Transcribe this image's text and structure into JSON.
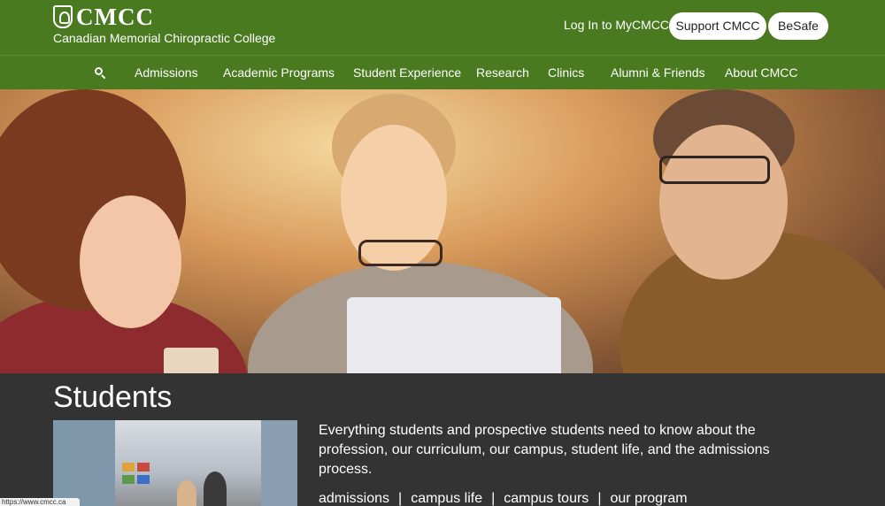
{
  "header": {
    "logo_text": "CMCC",
    "logo_subtitle": "Canadian Memorial Chiropractic College",
    "login_label": "Log In to MyCMCC",
    "support_label": "Support CMCC",
    "besafe_label": "BeSafe"
  },
  "nav": {
    "items": [
      {
        "label": "Admissions"
      },
      {
        "label": "Academic Programs"
      },
      {
        "label": "Student Experience"
      },
      {
        "label": "Research"
      },
      {
        "label": "Clinics"
      },
      {
        "label": "Alumni & Friends"
      },
      {
        "label": "About CMCC"
      }
    ]
  },
  "main": {
    "title": "Students",
    "intro": "Everything students and prospective students need to know about the profession, our curriculum, our campus, student life, and the admissions process.",
    "links": [
      {
        "label": "admissions"
      },
      {
        "label": "campus life"
      },
      {
        "label": "campus tours"
      },
      {
        "label": "our program"
      }
    ],
    "separator": "|"
  },
  "status_bar": {
    "url": "https://www.cmcc.ca"
  },
  "colors": {
    "brand_green": "#4a7a20",
    "content_bg": "#333333"
  }
}
